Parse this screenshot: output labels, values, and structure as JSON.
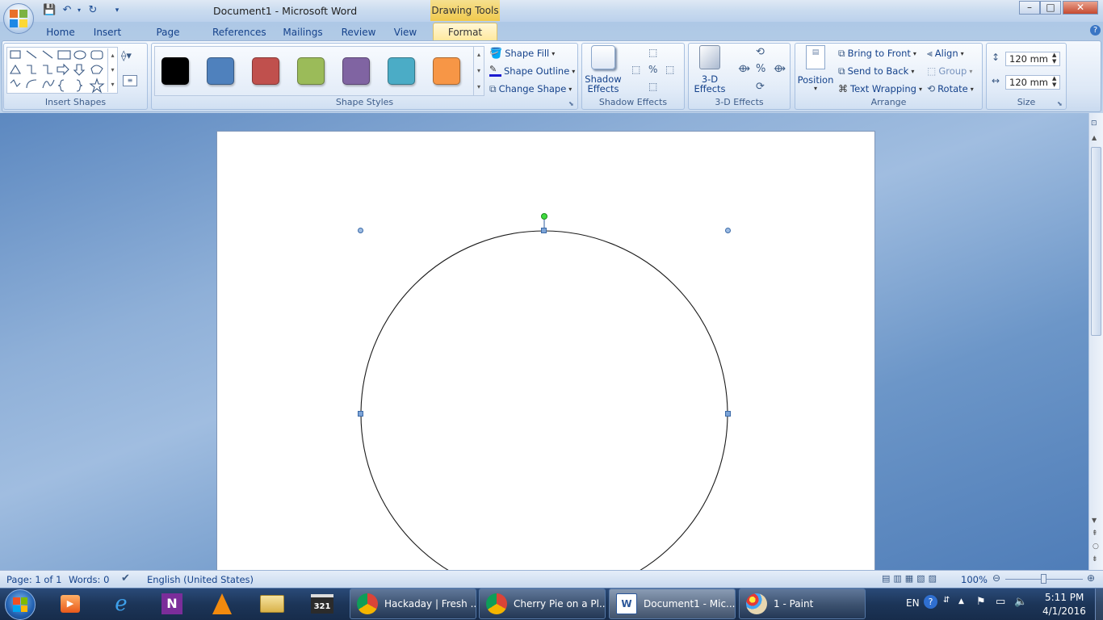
{
  "window": {
    "doc_title": "Document1 - Microsoft Word",
    "context_tab_label": "Drawing Tools",
    "minimize": "–",
    "maximize": "□",
    "close": "✕"
  },
  "tabs": [
    "Home",
    "Insert",
    "Page Layout",
    "References",
    "Mailings",
    "Review",
    "View",
    "Format"
  ],
  "active_tab": "Format",
  "ribbon": {
    "insert_shapes": {
      "label": "Insert Shapes"
    },
    "shape_styles": {
      "label": "Shape Styles",
      "swatches": [
        "#000000",
        "#4f81bd",
        "#c0504d",
        "#9bbb59",
        "#8064a2",
        "#4bacc6",
        "#f79646"
      ],
      "shape_fill": "Shape Fill",
      "shape_outline": "Shape Outline",
      "change_shape": "Change Shape"
    },
    "shadow_effects": {
      "label": "Shadow Effects",
      "btn_line1": "Shadow",
      "btn_line2": "Effects"
    },
    "three_d_effects": {
      "label": "3-D Effects",
      "btn_line1": "3-D",
      "btn_line2": "Effects"
    },
    "arrange": {
      "label": "Arrange",
      "position": "Position",
      "bring_to_front": "Bring to Front",
      "send_to_back": "Send to Back",
      "text_wrapping": "Text Wrapping",
      "align": "Align",
      "group": "Group",
      "rotate": "Rotate"
    },
    "size": {
      "label": "Size",
      "height": "120 mm",
      "width": "120 mm"
    }
  },
  "statusbar": {
    "page": "Page: 1 of 1",
    "words": "Words: 0",
    "language": "English (United States)",
    "zoom": "100%"
  },
  "taskbar": {
    "tasks": [
      {
        "label": "Hackaday | Fresh ...",
        "icon": "chrome-icon"
      },
      {
        "label": "Cherry Pie on a Pl...",
        "icon": "chrome-icon"
      },
      {
        "label": "Document1 - Mic...",
        "icon": "word-icon"
      },
      {
        "label": "1 - Paint",
        "icon": "paint-icon"
      }
    ],
    "language": "EN",
    "time": "5:11 PM",
    "date": "4/1/2016"
  },
  "colors": {
    "accent": "#15428b",
    "context_tab": "#f0c94d",
    "taskbar": "#1c3558"
  }
}
